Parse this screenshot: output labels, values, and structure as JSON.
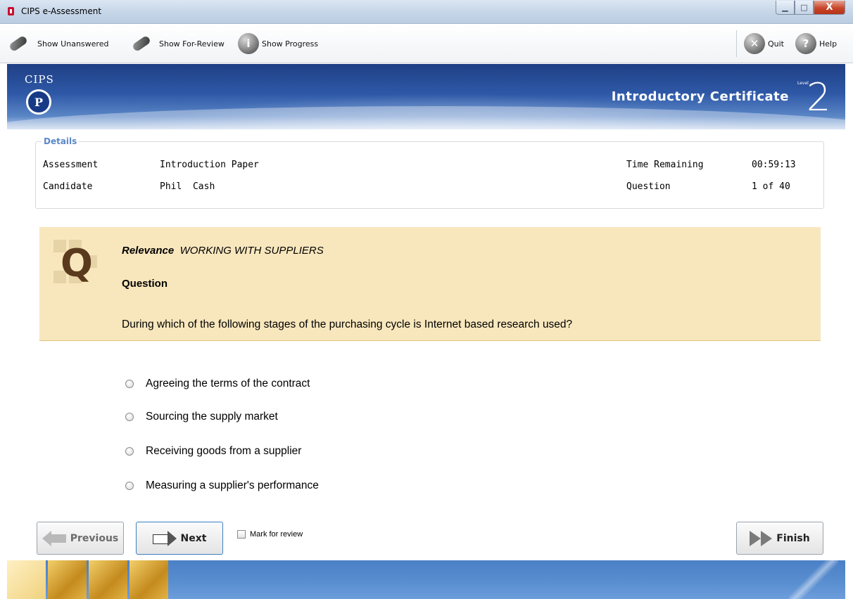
{
  "window": {
    "title": "CIPS e-Assessment",
    "minimize_glyph": "▁",
    "maximize_glyph": "□",
    "close_glyph": "X"
  },
  "toolbar": {
    "show_unanswered": "Show Unanswered",
    "show_for_review": "Show For-Review",
    "show_progress": "Show Progress",
    "quit": "Quit",
    "help": "Help",
    "icons": {
      "unanswered": "pencil-eraser-icon",
      "for_review": "pencil-star-icon",
      "progress": "info-icon",
      "quit": "puzzle-x-icon",
      "help": "question-icon"
    },
    "help_glyph": "?",
    "progress_glyph": "i",
    "quit_glyph": "✕"
  },
  "banner": {
    "org": "CIPS",
    "logo_mark": "P",
    "certificate": "Introductory Certificate",
    "level_word": "Level",
    "level_number": "2"
  },
  "details": {
    "legend": "Details",
    "assessment_label": "Assessment",
    "assessment_value": "Introduction Paper",
    "candidate_label": "Candidate",
    "candidate_value": "Phil  Cash",
    "time_label": "Time Remaining",
    "time_value": "00:59:13",
    "question_label": "Question",
    "question_value": "1 of 40"
  },
  "question": {
    "icon_letter": "Q",
    "relevance_label": "Relevance",
    "relevance_value": "WORKING WITH SUPPLIERS",
    "heading": "Question",
    "text": "During which of the following stages of the purchasing cycle is Internet based research used?"
  },
  "options": [
    "Agreeing the terms of the contract",
    "Sourcing the supply market",
    "Receiving goods from a supplier",
    "Measuring a supplier's performance"
  ],
  "nav": {
    "previous": "Previous",
    "next": "Next",
    "mark_for_review": "Mark for review",
    "finish": "Finish"
  },
  "colors": {
    "banner_blue": "#2e58a6",
    "question_panel": "#f8e7bd",
    "legend_blue": "#5b88c8",
    "footer_blue": "#5a8fd1"
  }
}
